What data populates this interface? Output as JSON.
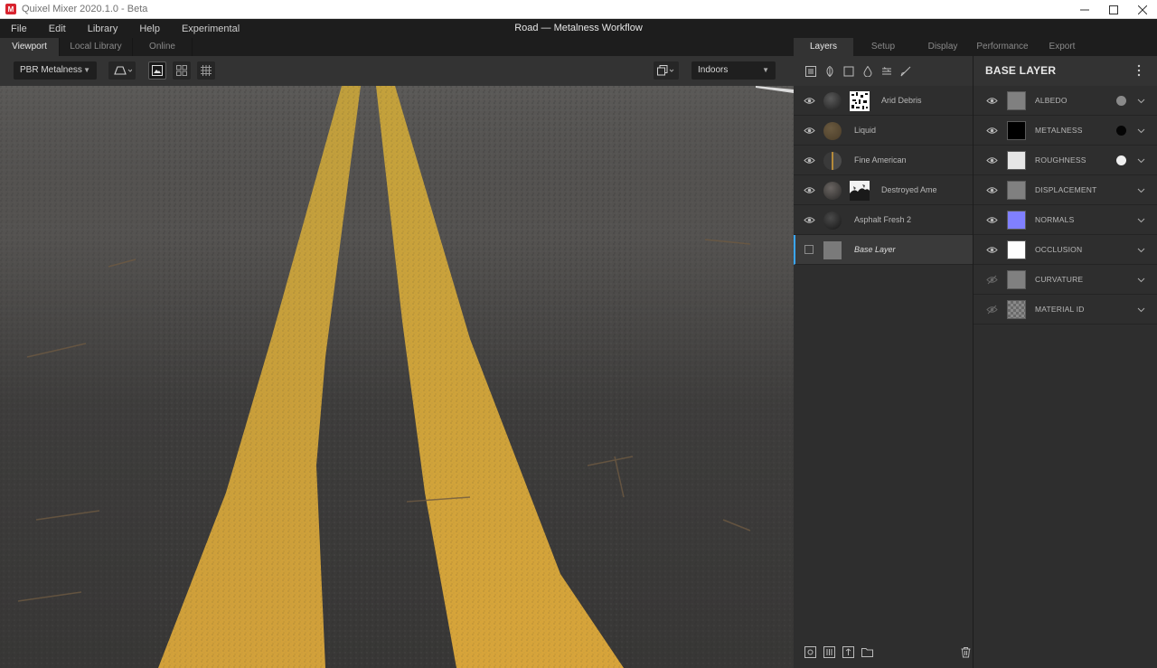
{
  "window": {
    "app_title": "Quixel Mixer 2020.1.0 - Beta",
    "doc_title": "Road — Metalness Workflow"
  },
  "menu": [
    "File",
    "Edit",
    "Library",
    "Help",
    "Experimental"
  ],
  "viewport_tabs": [
    "Viewport",
    "Local Library",
    "Online"
  ],
  "right_tabs": [
    "Layers",
    "Setup",
    "Display",
    "Performance",
    "Export"
  ],
  "toolbar": {
    "workflow": "PBR Metalness",
    "environment": "Indoors"
  },
  "layers": [
    {
      "name": "Arid Debris",
      "visible": true,
      "thumb": "#303030",
      "mask": "noise"
    },
    {
      "name": "Liquid",
      "visible": true,
      "thumb": "#5a4a33",
      "mask": ""
    },
    {
      "name": "Fine American",
      "visible": true,
      "thumb": "#4a4744",
      "mask": ""
    },
    {
      "name": "Destroyed Ame",
      "visible": true,
      "thumb": "#3c3b3a",
      "mask": "grunge"
    },
    {
      "name": "Asphalt Fresh 2",
      "visible": true,
      "thumb": "#2a2a2a",
      "mask": ""
    },
    {
      "name": "Base Layer",
      "visible": false,
      "thumb": "#7a7a7a",
      "mask": ""
    }
  ],
  "base_layer": {
    "title": "BASE LAYER",
    "channels": [
      {
        "name": "ALBEDO",
        "color": "#808080",
        "dot": "#8a8a8a",
        "visible": true
      },
      {
        "name": "METALNESS",
        "color": "#000000",
        "dot": "#050505",
        "visible": true
      },
      {
        "name": "ROUGHNESS",
        "color": "#e6e6e6",
        "dot": "#f0f0f0",
        "visible": true
      },
      {
        "name": "DISPLACEMENT",
        "color": "#808080",
        "dot": "",
        "visible": true
      },
      {
        "name": "NORMALS",
        "color": "#8080ff",
        "dot": "",
        "visible": true
      },
      {
        "name": "OCCLUSION",
        "color": "#ffffff",
        "dot": "",
        "visible": true
      },
      {
        "name": "CURVATURE",
        "color": "#808080",
        "dot": "",
        "visible": false
      },
      {
        "name": "MATERIAL ID",
        "color": "checker",
        "dot": "",
        "visible": false
      }
    ]
  }
}
